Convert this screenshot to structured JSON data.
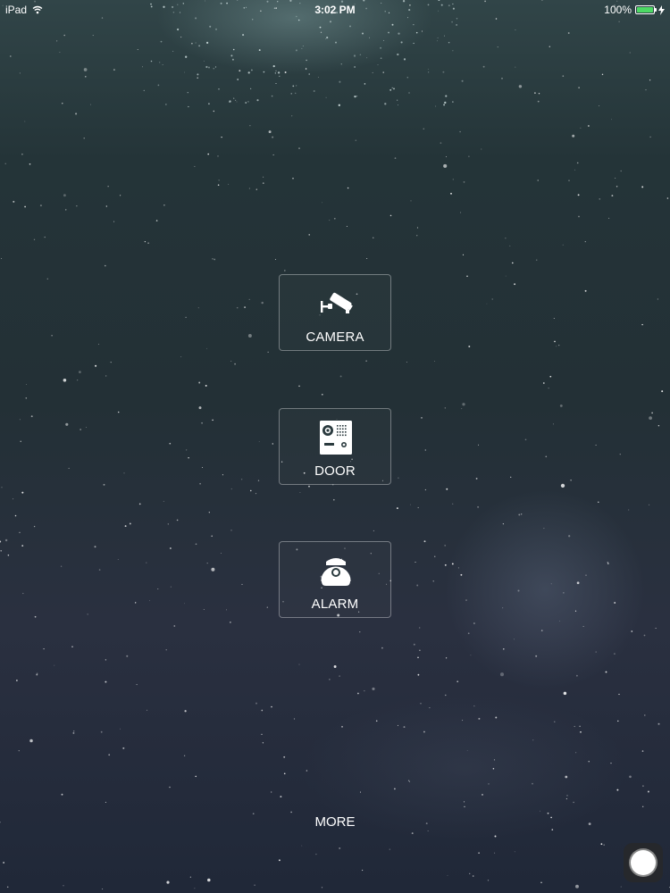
{
  "status_bar": {
    "device": "iPad",
    "time": "3:02 PM",
    "battery_percent": "100%",
    "battery_level": 1.0,
    "battery_color": "#4cd964",
    "wifi_icon": "wifi-icon",
    "charging_icon": "charging-bolt-icon"
  },
  "menu": {
    "camera": {
      "label": "CAMERA",
      "icon": "security-camera-icon"
    },
    "door": {
      "label": "DOOR",
      "icon": "door-intercom-icon"
    },
    "alarm": {
      "label": "ALARM",
      "icon": "alarm-sensor-icon"
    }
  },
  "footer": {
    "more_label": "MORE"
  },
  "assistive_touch": {
    "icon": "assistive-touch-icon"
  }
}
